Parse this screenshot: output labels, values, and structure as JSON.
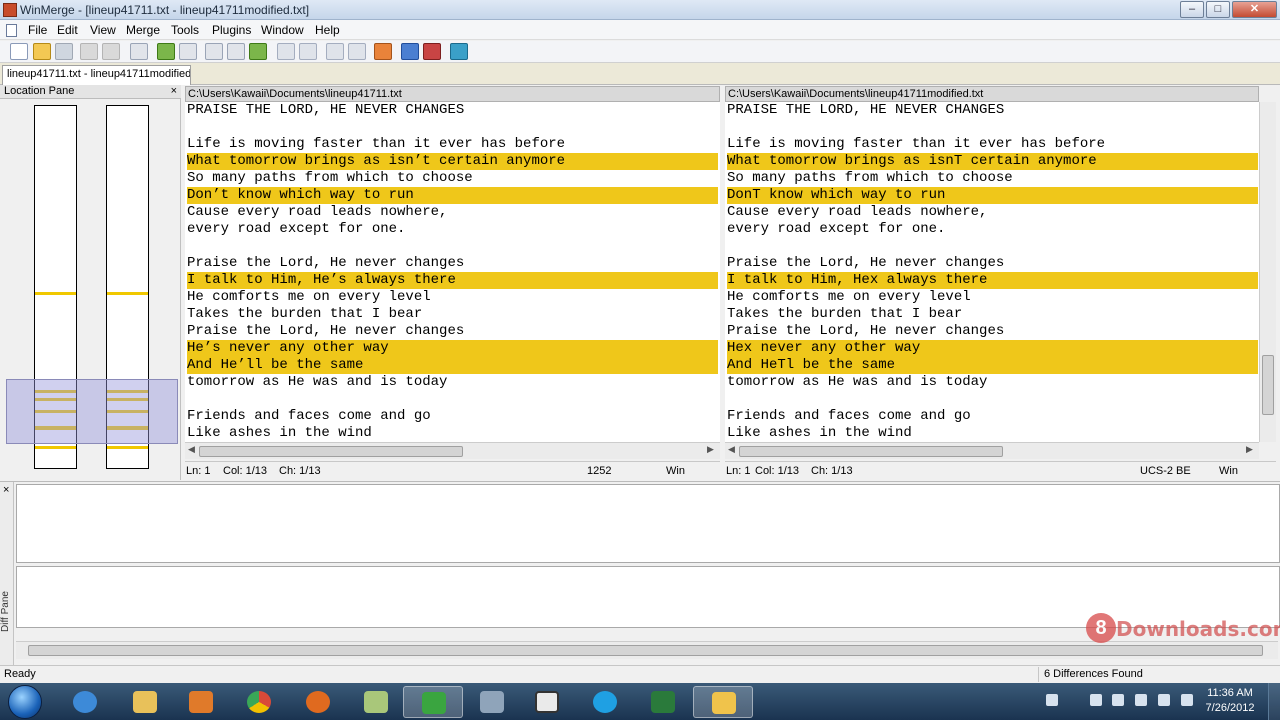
{
  "window": {
    "title": "WinMerge - [lineup41711.txt - lineup41711modified.txt]",
    "min_glyph": "–",
    "max_glyph": "□",
    "close_glyph": "✕"
  },
  "menu": [
    "File",
    "Edit",
    "View",
    "Merge",
    "Tools",
    "Plugins",
    "Window",
    "Help"
  ],
  "tab": {
    "label": "lineup41711.txt - lineup41711modified.txt"
  },
  "location_pane": {
    "title": "Location Pane",
    "close_glyph": "×"
  },
  "left": {
    "path": "C:\\Users\\Kawaii\\Documents\\lineup41711.txt",
    "lines": [
      {
        "text": "PRAISE THE LORD, HE NEVER CHANGES",
        "diff": false
      },
      {
        "text": "",
        "diff": false
      },
      {
        "text": "Life is moving faster than it ever has before",
        "diff": false
      },
      {
        "text": "What tomorrow brings as isn’t certain anymore",
        "diff": true
      },
      {
        "text": "So many paths from which to choose",
        "diff": false
      },
      {
        "text": "Don’t know which way to run",
        "diff": true
      },
      {
        "text": "Cause every road leads nowhere,",
        "diff": false
      },
      {
        "text": "every road except for one.",
        "diff": false
      },
      {
        "text": "",
        "diff": false
      },
      {
        "text": "Praise the Lord, He never changes",
        "diff": false
      },
      {
        "text": "I talk to Him, He’s always there",
        "diff": true
      },
      {
        "text": "He comforts me on every level",
        "diff": false
      },
      {
        "text": "Takes the burden that I bear",
        "diff": false
      },
      {
        "text": "Praise the Lord, He never changes",
        "diff": false
      },
      {
        "text": "He’s never any other way",
        "diff": true
      },
      {
        "text": "And He’ll be the same",
        "diff": true
      },
      {
        "text": "tomorrow as He was and is today",
        "diff": false
      },
      {
        "text": "",
        "diff": false
      },
      {
        "text": "Friends and faces come and go",
        "diff": false
      },
      {
        "text": "Like ashes in the wind",
        "diff": false
      }
    ],
    "status": {
      "ln": "Ln: 1",
      "col": "Col: 1/13",
      "ch": "Ch: 1/13",
      "count": "1252",
      "eol": "Win"
    }
  },
  "right": {
    "path": "C:\\Users\\Kawaii\\Documents\\lineup41711modified.txt",
    "lines": [
      {
        "text": "PRAISE THE LORD, HE NEVER CHANGES",
        "diff": false
      },
      {
        "text": "",
        "diff": false
      },
      {
        "text": "Life is moving faster than it ever has before",
        "diff": false
      },
      {
        "text": "What tomorrow brings as isnT certain anymore",
        "diff": true
      },
      {
        "text": "So many paths from which to choose",
        "diff": false
      },
      {
        "text": "DonT know which way to run",
        "diff": true
      },
      {
        "text": "Cause every road leads nowhere,",
        "diff": false
      },
      {
        "text": "every road except for one.",
        "diff": false
      },
      {
        "text": "",
        "diff": false
      },
      {
        "text": "Praise the Lord, He never changes",
        "diff": false
      },
      {
        "text": "I talk to Him, Hex always there",
        "diff": true
      },
      {
        "text": "He comforts me on every level",
        "diff": false
      },
      {
        "text": "Takes the burden that I bear",
        "diff": false
      },
      {
        "text": "Praise the Lord, He never changes",
        "diff": false
      },
      {
        "text": "Hex never any other way",
        "diff": true
      },
      {
        "text": "And HeTl be the same",
        "diff": true
      },
      {
        "text": "tomorrow as He was and is today",
        "diff": false
      },
      {
        "text": "",
        "diff": false
      },
      {
        "text": "Friends and faces come and go",
        "diff": false
      },
      {
        "text": "Like ashes in the wind",
        "diff": false
      }
    ],
    "status": {
      "ln": "Ln: 1",
      "col": "Col: 1/13",
      "ch": "Ch: 1/13",
      "encoding": "UCS-2 BE",
      "eol": "Win"
    }
  },
  "diff_pane": {
    "label": "Diff Pane",
    "close_glyph": "×"
  },
  "statusbar": {
    "left": "Ready",
    "right": "6 Differences Found"
  },
  "watermark": {
    "badge": "8",
    "text": "Downloads.com"
  },
  "clock": {
    "time": "11:36 AM",
    "date": "7/26/2012"
  },
  "colors": {
    "diff_highlight": "#efc71a",
    "title_accent": "#c5d6ea",
    "taskbar": "#1a3350"
  },
  "taskbar_apps": [
    "internet-explorer",
    "file-explorer",
    "media-player",
    "chrome",
    "firefox",
    "notes",
    "camtasia",
    "tool",
    "window-app",
    "skype",
    "excel",
    "winmerge"
  ]
}
